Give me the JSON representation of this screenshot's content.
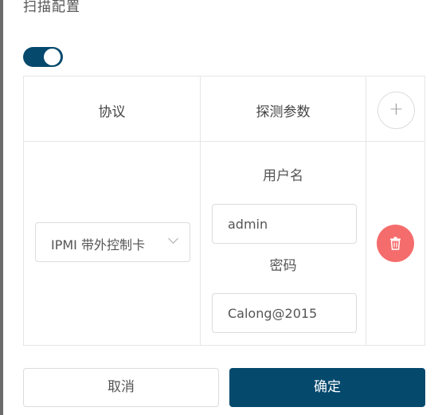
{
  "section": {
    "title": "扫描配置"
  },
  "toggle": {
    "enabled": true
  },
  "table": {
    "headers": {
      "protocol": "协议",
      "params": "探测参数"
    },
    "add_icon": "plus-icon",
    "rows": [
      {
        "protocol_value": "IPMI 带外控制卡",
        "username_label": "用户名",
        "username_value": "admin",
        "password_label": "密码",
        "password_value": "Calong@2015",
        "delete_icon": "trash-icon"
      }
    ]
  },
  "footer": {
    "cancel_label": "取消",
    "confirm_label": "确定"
  },
  "colors": {
    "primary": "#05496d",
    "danger": "#f56c6c",
    "border": "#e6e6e6"
  }
}
